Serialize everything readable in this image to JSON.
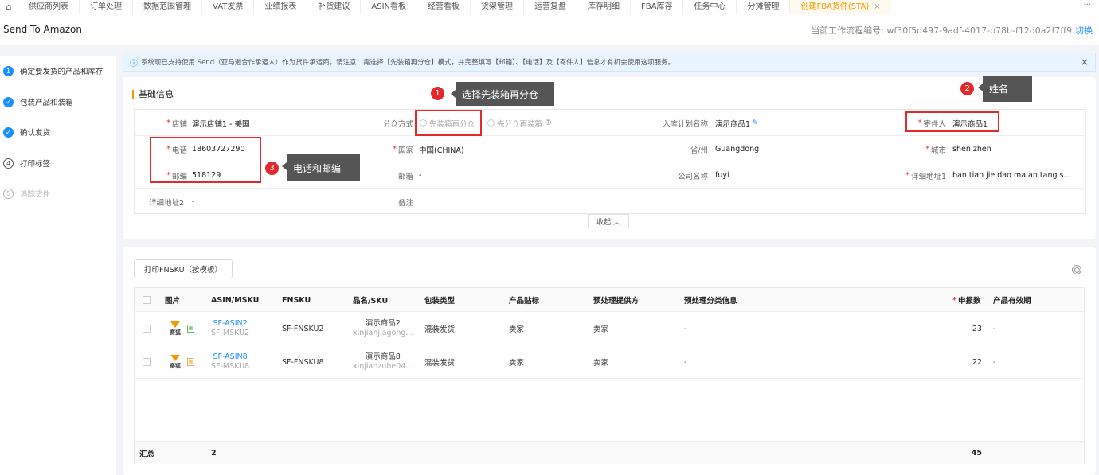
{
  "nav": {
    "tabs": [
      "供应商列表",
      "订单处理",
      "数据范围管理",
      "VAT发票",
      "业绩报表",
      "补货建议",
      "ASIN看板",
      "经营看板",
      "货架管理",
      "运营复盘",
      "库存明细",
      "FBA库存",
      "任务中心",
      "分摊管理"
    ],
    "active_tab": "创建FBA货件(STA)",
    "close": "×",
    "more": "···",
    "home": "⌂"
  },
  "page": {
    "title": "Send To Amazon",
    "flow_label": "当前工作流程编号:",
    "flow_id": "wf30f5d497-9adf-4017-b78b-f12d0a2f7ff9",
    "switch": "切换"
  },
  "steps": [
    {
      "num": "1",
      "label": "确定要发货的产品和库存",
      "state": "current"
    },
    {
      "num": "✓",
      "label": "包装产品和装箱",
      "state": "done"
    },
    {
      "num": "✓",
      "label": "确认发货",
      "state": "done"
    },
    {
      "num": "4",
      "label": "打印标签",
      "state": "todo"
    },
    {
      "num": "5",
      "label": "追踪货件",
      "state": "disabled"
    }
  ],
  "banner": {
    "icon": "ⓘ",
    "text": "系统现已支持使用 Send（亚马逊合作承运人）作为货件承运商。请注意：需选择【先装箱再分仓】模式，并完整填写【邮箱】、【电话】及【寄件人】信息才有机会使用这项服务。",
    "close": "×"
  },
  "basic": {
    "title": "基础信息",
    "store_label": "店铺",
    "store": "演示店铺1 - 美国",
    "split_label": "分仓方式",
    "split_opt1": "先装箱再分仓",
    "split_opt2": "先分仓再装箱",
    "help": "⑦",
    "plan_label": "入库计划名称",
    "plan": "演示商品1",
    "sender_label": "寄件人",
    "sender": "演示商品1",
    "phone_label": "电话",
    "phone": "18603727290",
    "country_label": "国家",
    "country": "中国(CHINA)",
    "province_label": "省/州",
    "province": "Guangdong",
    "city_label": "城市",
    "city": "shen zhen",
    "zip_label": "邮编",
    "zip": "518129",
    "email_label": "邮箱",
    "email": "-",
    "company_label": "公司名称",
    "company": "fuyi",
    "addr1_label": "详细地址1",
    "addr1": "ban tian jie dao ma an tang s...",
    "addr2_label": "详细地址2",
    "addr2": "-",
    "remark_label": "备注",
    "collapse": "收起 ︿"
  },
  "annotations": [
    {
      "num": "1",
      "text": "选择先装箱再分仓"
    },
    {
      "num": "2",
      "text": "姓名"
    },
    {
      "num": "3",
      "text": "电话和邮编"
    }
  ],
  "products": {
    "print_button": "打印FNSKU（按模板）",
    "headers": [
      "图片",
      "ASIN/MSKU",
      "FNSKU",
      "品名/SKU",
      "包装类型",
      "产品贴标",
      "预处理提供方",
      "预处理分类信息",
      "申报数",
      "产品有效期"
    ],
    "rows": [
      {
        "brand": "赛狐",
        "asin": "SF-ASIN2",
        "msku": "SF-MSKU2",
        "fnsku": "SF-FNSKU2",
        "name": "演示商品2",
        "sku": "xinjianjiagong...",
        "pack": "混装发货",
        "label": "卖家",
        "prep": "卖家",
        "prep_cat": "-",
        "qty": "23",
        "expiry": "-"
      },
      {
        "brand": "赛狐",
        "asin": "SF-ASIN8",
        "msku": "SF-MSKU8",
        "fnsku": "SF-FNSKU8",
        "name": "演示商品8",
        "sku": "xinjianzuhe04...",
        "pack": "混装发货",
        "label": "卖家",
        "prep": "卖家",
        "prep_cat": "-",
        "qty": "22",
        "expiry": "-"
      }
    ],
    "total_label": "汇总",
    "total_count": "2",
    "total_qty": "45"
  }
}
